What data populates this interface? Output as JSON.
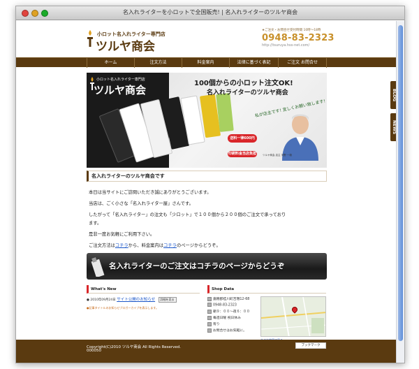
{
  "window": {
    "title": "名入れライターを小ロットで全国販売! | 名入れライターのツルヤ商会"
  },
  "header": {
    "logo_small": "小ロット名入れライター専門店",
    "logo_big": "ツルヤ商会",
    "contact_note": "★ご注文・お問合せ受付時間 10時～18時",
    "phone": "0948-83-2323",
    "url": "http://tsuruya.hss-net.com/"
  },
  "nav": {
    "items": [
      {
        "label": "ホーム"
      },
      {
        "label": "注文方法"
      },
      {
        "label": "料金案内"
      },
      {
        "label": "法律に基づく表記"
      },
      {
        "label": "ご注文 お問合せ"
      }
    ]
  },
  "side_tabs": {
    "blog": "BLOG",
    "news": "NEWS"
  },
  "hero": {
    "logo_small": "小ロット名入れライター専門店",
    "logo_big": "ツルヤ商会",
    "headline": "100個からの小ロット注文OK!",
    "subheadline": "名入れライターのツルヤ商会",
    "note": "私が店主です! 宜しくお願い致します!",
    "badge1": "送料一律600円",
    "badge2": "印刷料金当店負担",
    "caption": "ツルヤ商会 店主 河野 一雄"
  },
  "section": {
    "title": "名入れライターのツルヤ商会です"
  },
  "paragraphs": {
    "p1": "本日は当サイトにご訪問いただき誠にありがとうございます。",
    "p2": "当店は、ごく小さな「名入れライター屋」さんです。",
    "p3": "したがって「名入れライター」の注文も「少ロット」で１００個から２００個のご注文で承っており",
    "p3b": "ます。",
    "p4": "是非一度お気軽にご利用下さい。",
    "p5_pre": "ご注文方法は",
    "p5_link1": "コチラ",
    "p5_mid": "から、料金案内は",
    "p5_link2": "コチラ",
    "p5_post": "のページからどうぞ。"
  },
  "order_banner": {
    "text": "名入れライターのご注文はコチラのページからどうぞ"
  },
  "whats_new": {
    "title": "What's New",
    "date": "● 2010年09月24日",
    "link": "サイト公開のお知らせ",
    "button": "詳細を見る",
    "note": "●記事タイトルのお知らせブロガーカイブを表示します。"
  },
  "shop_data": {
    "title": "Shop Data",
    "rows": [
      "嘉穂郡桂川町吉隈12-68",
      "0948-83-2323",
      "朝９：００～夜６：００",
      "毎週日曜 祝日休み",
      "有り",
      "お問合せはお気軽に。"
    ],
    "map_link": "大きな地図で見る"
  },
  "footer": {
    "copyright": "Copyright(C)2010 ツルヤ商会 All Rights Reserved.",
    "counter": "000050",
    "bookmark": "ブックマーク"
  },
  "colors": {
    "brand_brown": "#5a3a10",
    "accent_red": "#d9262a",
    "link_blue": "#1a55c8",
    "phone_gold": "#c8902a"
  }
}
